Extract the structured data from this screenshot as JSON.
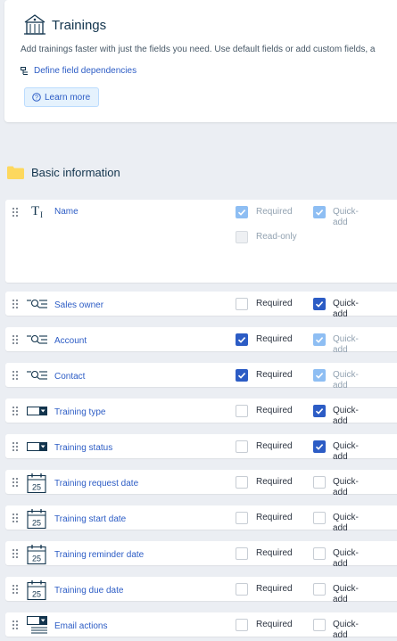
{
  "header": {
    "title": "Trainings",
    "description": "Add trainings faster with just the fields you need. Use default fields or add custom fields, a",
    "dependencies_link": "Define field dependencies",
    "learn_more": "Learn more"
  },
  "section": {
    "title": "Basic information"
  },
  "labels": {
    "required": "Required",
    "quick_add_1": "Quick-",
    "quick_add_2": "add",
    "read_only": "Read-only"
  },
  "fields": [
    {
      "name": "Name",
      "icon": "text-field-icon",
      "required": "checked-disabled",
      "quick_add": "checked-disabled",
      "read_only": "unchecked-disabled"
    },
    {
      "name": "Sales owner",
      "icon": "lookup-field-icon",
      "required": "unchecked",
      "quick_add": "checked"
    },
    {
      "name": "Account",
      "icon": "lookup-field-icon",
      "required": "checked",
      "quick_add": "checked-disabled"
    },
    {
      "name": "Contact",
      "icon": "lookup-field-icon",
      "required": "checked",
      "quick_add": "checked-disabled"
    },
    {
      "name": "Training type",
      "icon": "dropdown-field-icon",
      "required": "unchecked",
      "quick_add": "checked"
    },
    {
      "name": "Training status",
      "icon": "dropdown-field-icon",
      "required": "unchecked",
      "quick_add": "checked"
    },
    {
      "name": "Training request date",
      "icon": "calendar-field-icon",
      "calendar_day": "25",
      "required": "unchecked",
      "quick_add": "unchecked"
    },
    {
      "name": "Training start date",
      "icon": "calendar-field-icon",
      "calendar_day": "25",
      "required": "unchecked",
      "quick_add": "unchecked"
    },
    {
      "name": "Training reminder date",
      "icon": "calendar-field-icon",
      "calendar_day": "25",
      "required": "unchecked",
      "quick_add": "unchecked"
    },
    {
      "name": "Training due date",
      "icon": "calendar-field-icon",
      "calendar_day": "25",
      "required": "unchecked",
      "quick_add": "unchecked"
    },
    {
      "name": "Email actions",
      "icon": "multiselect-field-icon",
      "required": "unchecked",
      "quick_add": "unchecked"
    }
  ],
  "colors": {
    "accent": "#2c5cc5",
    "checked_disabled": "#8ebef3",
    "page_bg": "#ebeef3"
  }
}
